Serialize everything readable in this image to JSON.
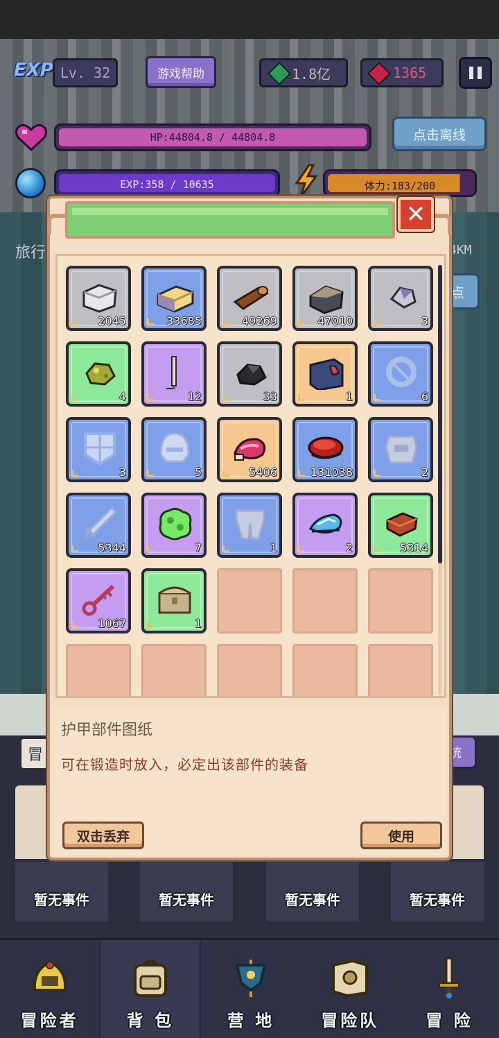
{
  "hud": {
    "exp_logo": "EXP",
    "level": "Lv. 32",
    "help_label": "游戏帮助",
    "gem_value": "1.8亿",
    "ruby_value": "1365",
    "hp_text": "HP:44804.8 / 44804.8",
    "hp_fraction": 1.0,
    "exp_text": "EXP:358 / 10635",
    "exp_fraction": 0.034,
    "stamina_text": "体力:183/200",
    "stamina_fraction": 0.915,
    "offline_label": "点击离线"
  },
  "background": {
    "left_text": "旅行",
    "right_text": "4KM",
    "right_button": "点",
    "left_tab_glyph": "冒",
    "right_tab_text": "统"
  },
  "inventory": {
    "items": [
      {
        "icon": "stone-block-icon",
        "rarity": "gray",
        "qty": "2045"
      },
      {
        "icon": "gold-bar-icon",
        "rarity": "blue",
        "qty": "33685"
      },
      {
        "icon": "wood-log-icon",
        "rarity": "gray",
        "qty": "49269"
      },
      {
        "icon": "iron-ore-icon",
        "rarity": "gray",
        "qty": "47010"
      },
      {
        "icon": "crystal-ore-icon",
        "rarity": "gray",
        "qty": "3"
      },
      {
        "icon": "gold-nugget-icon",
        "rarity": "green",
        "qty": "4"
      },
      {
        "icon": "needle-icon",
        "rarity": "purple",
        "qty": "12"
      },
      {
        "icon": "coal-icon",
        "rarity": "gray",
        "qty": "33"
      },
      {
        "icon": "spell-book-icon",
        "rarity": "orange",
        "qty": "1"
      },
      {
        "icon": "ring-blueprint-icon",
        "rarity": "blue",
        "qty": "6"
      },
      {
        "icon": "shield-blueprint-icon",
        "rarity": "blue",
        "qty": "3"
      },
      {
        "icon": "helmet-blueprint-icon",
        "rarity": "blue",
        "qty": "5"
      },
      {
        "icon": "ruby-meat-icon",
        "rarity": "orange",
        "qty": "5406"
      },
      {
        "icon": "red-meat-icon",
        "rarity": "blue",
        "qty": "131038"
      },
      {
        "icon": "armor-blueprint-icon",
        "rarity": "blue",
        "qty": "2"
      },
      {
        "icon": "sword-blueprint-icon",
        "rarity": "blue",
        "qty": "5344"
      },
      {
        "icon": "green-slime-icon",
        "rarity": "purple",
        "qty": "7"
      },
      {
        "icon": "pants-blueprint-icon",
        "rarity": "blue",
        "qty": "1"
      },
      {
        "icon": "blue-crystal-icon",
        "rarity": "purple",
        "qty": "2"
      },
      {
        "icon": "brick-icon",
        "rarity": "green",
        "qty": "5314"
      },
      {
        "icon": "magic-key-icon",
        "rarity": "purple",
        "qty": "1067"
      },
      {
        "icon": "treasure-chest-icon",
        "rarity": "green",
        "qty": "1"
      }
    ],
    "selected_title": "护甲部件图纸",
    "selected_desc": "可在锻造时放入，必定出该部件的装备",
    "discard_label": "双击丢弃",
    "use_label": "使用",
    "close_glyph": "✕"
  },
  "events": [
    "暂无事件",
    "暂无事件",
    "暂无事件",
    "暂无事件"
  ],
  "nav": [
    {
      "label": "冒险者",
      "icon": "adventurer-helmet-icon"
    },
    {
      "label": "背 包",
      "icon": "backpack-icon"
    },
    {
      "label": "营 地",
      "icon": "camp-banner-icon"
    },
    {
      "label": "冒险队",
      "icon": "team-book-icon"
    },
    {
      "label": "冒 险",
      "icon": "sword-icon"
    }
  ],
  "colors": {
    "hp_fill": "#c45ab0",
    "exp_fill": "#6a3ac8",
    "stamina_fill": "#d88a28",
    "rarity_gray": "#bfbfc3",
    "rarity_blue": "#7f9fe8",
    "rarity_purple": "#c49cf0",
    "rarity_green": "#8ee89a",
    "rarity_orange": "#f6c890"
  }
}
